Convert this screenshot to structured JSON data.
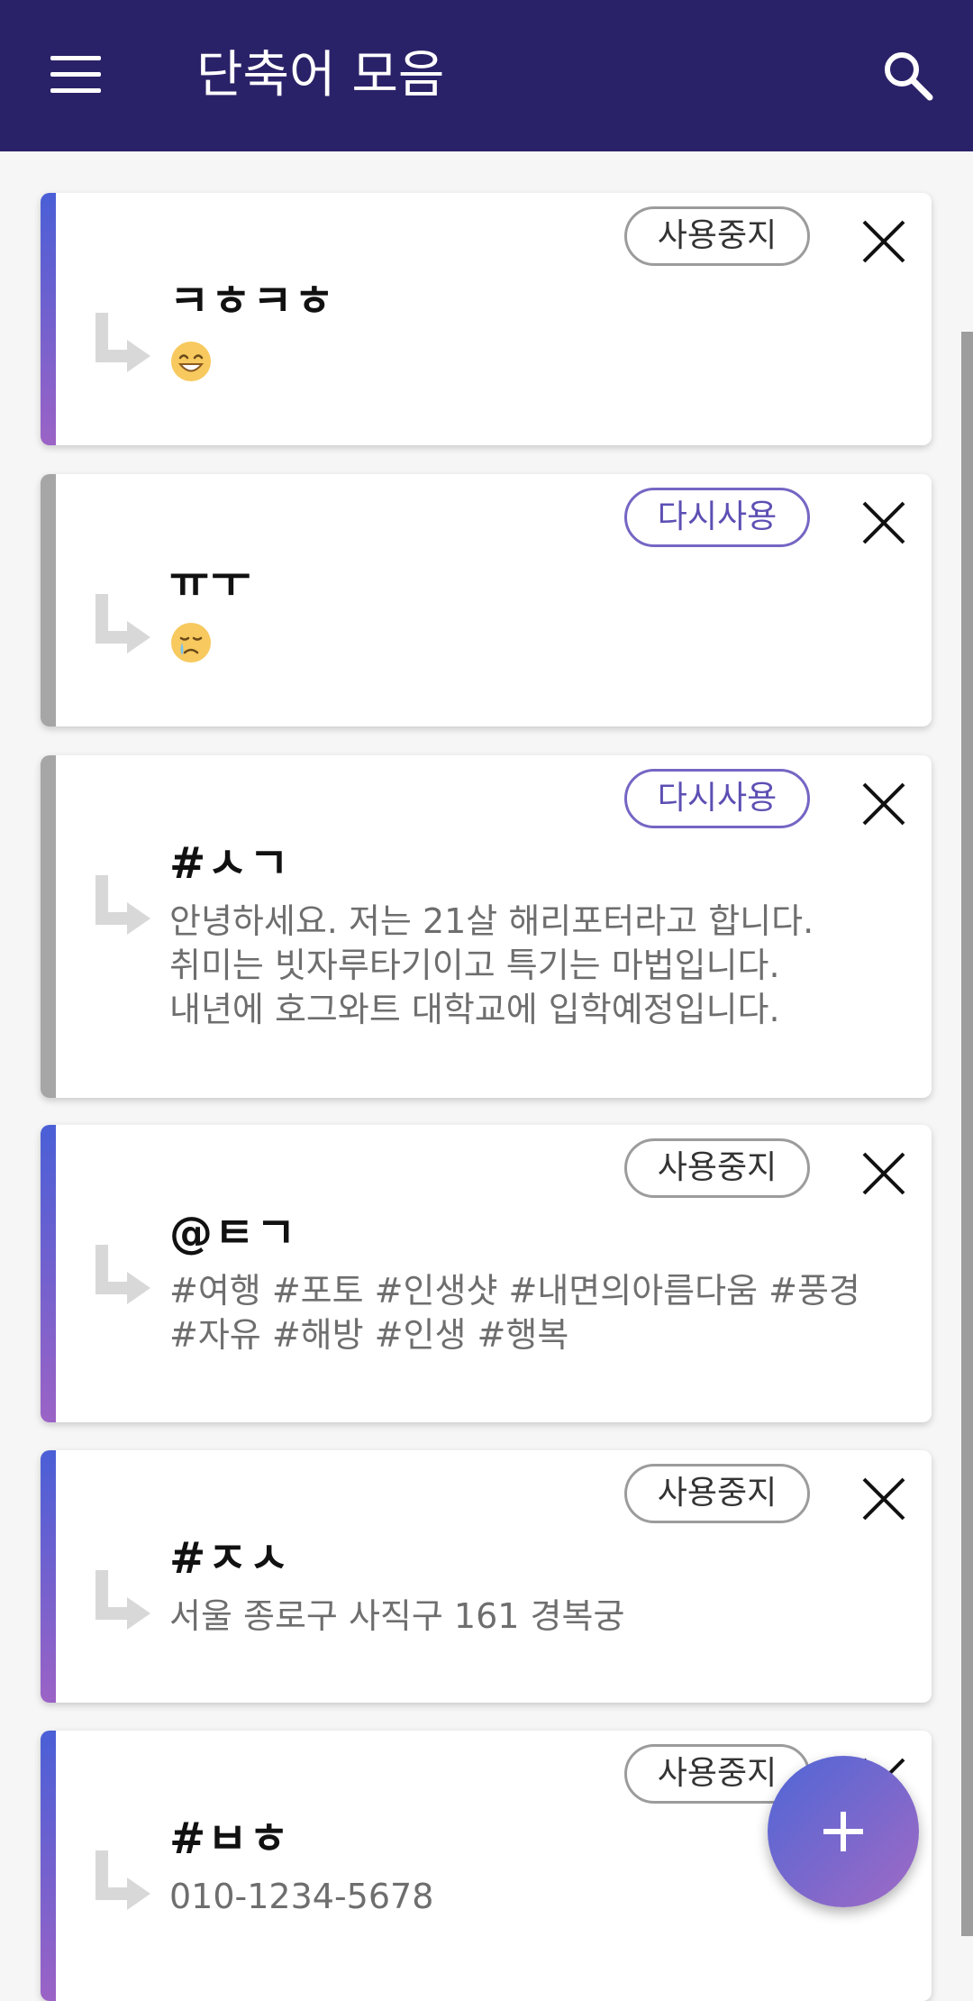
{
  "appbar": {
    "title": "단축어 모음",
    "background": "#2a2268",
    "menu_icon": "hamburger-menu-icon",
    "search_icon": "search-icon"
  },
  "accent_colors": {
    "active_start": "#4a5fd6",
    "active_end": "#9b63c6",
    "inactive": "#a6a6a6"
  },
  "shortcuts": [
    {
      "keyword": "ㅋㅎㅋㅎ",
      "emoji": "grinning-face-emoji",
      "status_label": "사용중지",
      "active": true
    },
    {
      "keyword": "ㅠㅜ",
      "emoji": "crying-face-emoji",
      "status_label": "다시사용",
      "active": false
    },
    {
      "keyword": "#ㅅㄱ",
      "phrase_lines": [
        "안녕하세요. 저는 21살 해리포터라고 합니다.",
        "취미는 빗자루타기이고 특기는 마법입니다.",
        "내년에 호그와트 대학교에 입학예정입니다."
      ],
      "status_label": "다시사용",
      "active": false
    },
    {
      "keyword": "@ㅌㄱ",
      "phrase_lines": [
        "#여행 #포토 #인생샷 #내면의아름다움 #풍경",
        "#자유 #해방 #인생 #행복"
      ],
      "status_label": "사용중지",
      "active": true
    },
    {
      "keyword": "#ㅈㅅ",
      "phrase_lines": [
        "서울 종로구 사직구 161 경복궁"
      ],
      "status_label": "사용중지",
      "active": true
    },
    {
      "keyword": "#ㅂㅎ",
      "phrase_lines": [
        "010-1234-5678"
      ],
      "status_label": "사용중지",
      "active": true
    }
  ],
  "fab": {
    "icon": "plus-icon"
  }
}
